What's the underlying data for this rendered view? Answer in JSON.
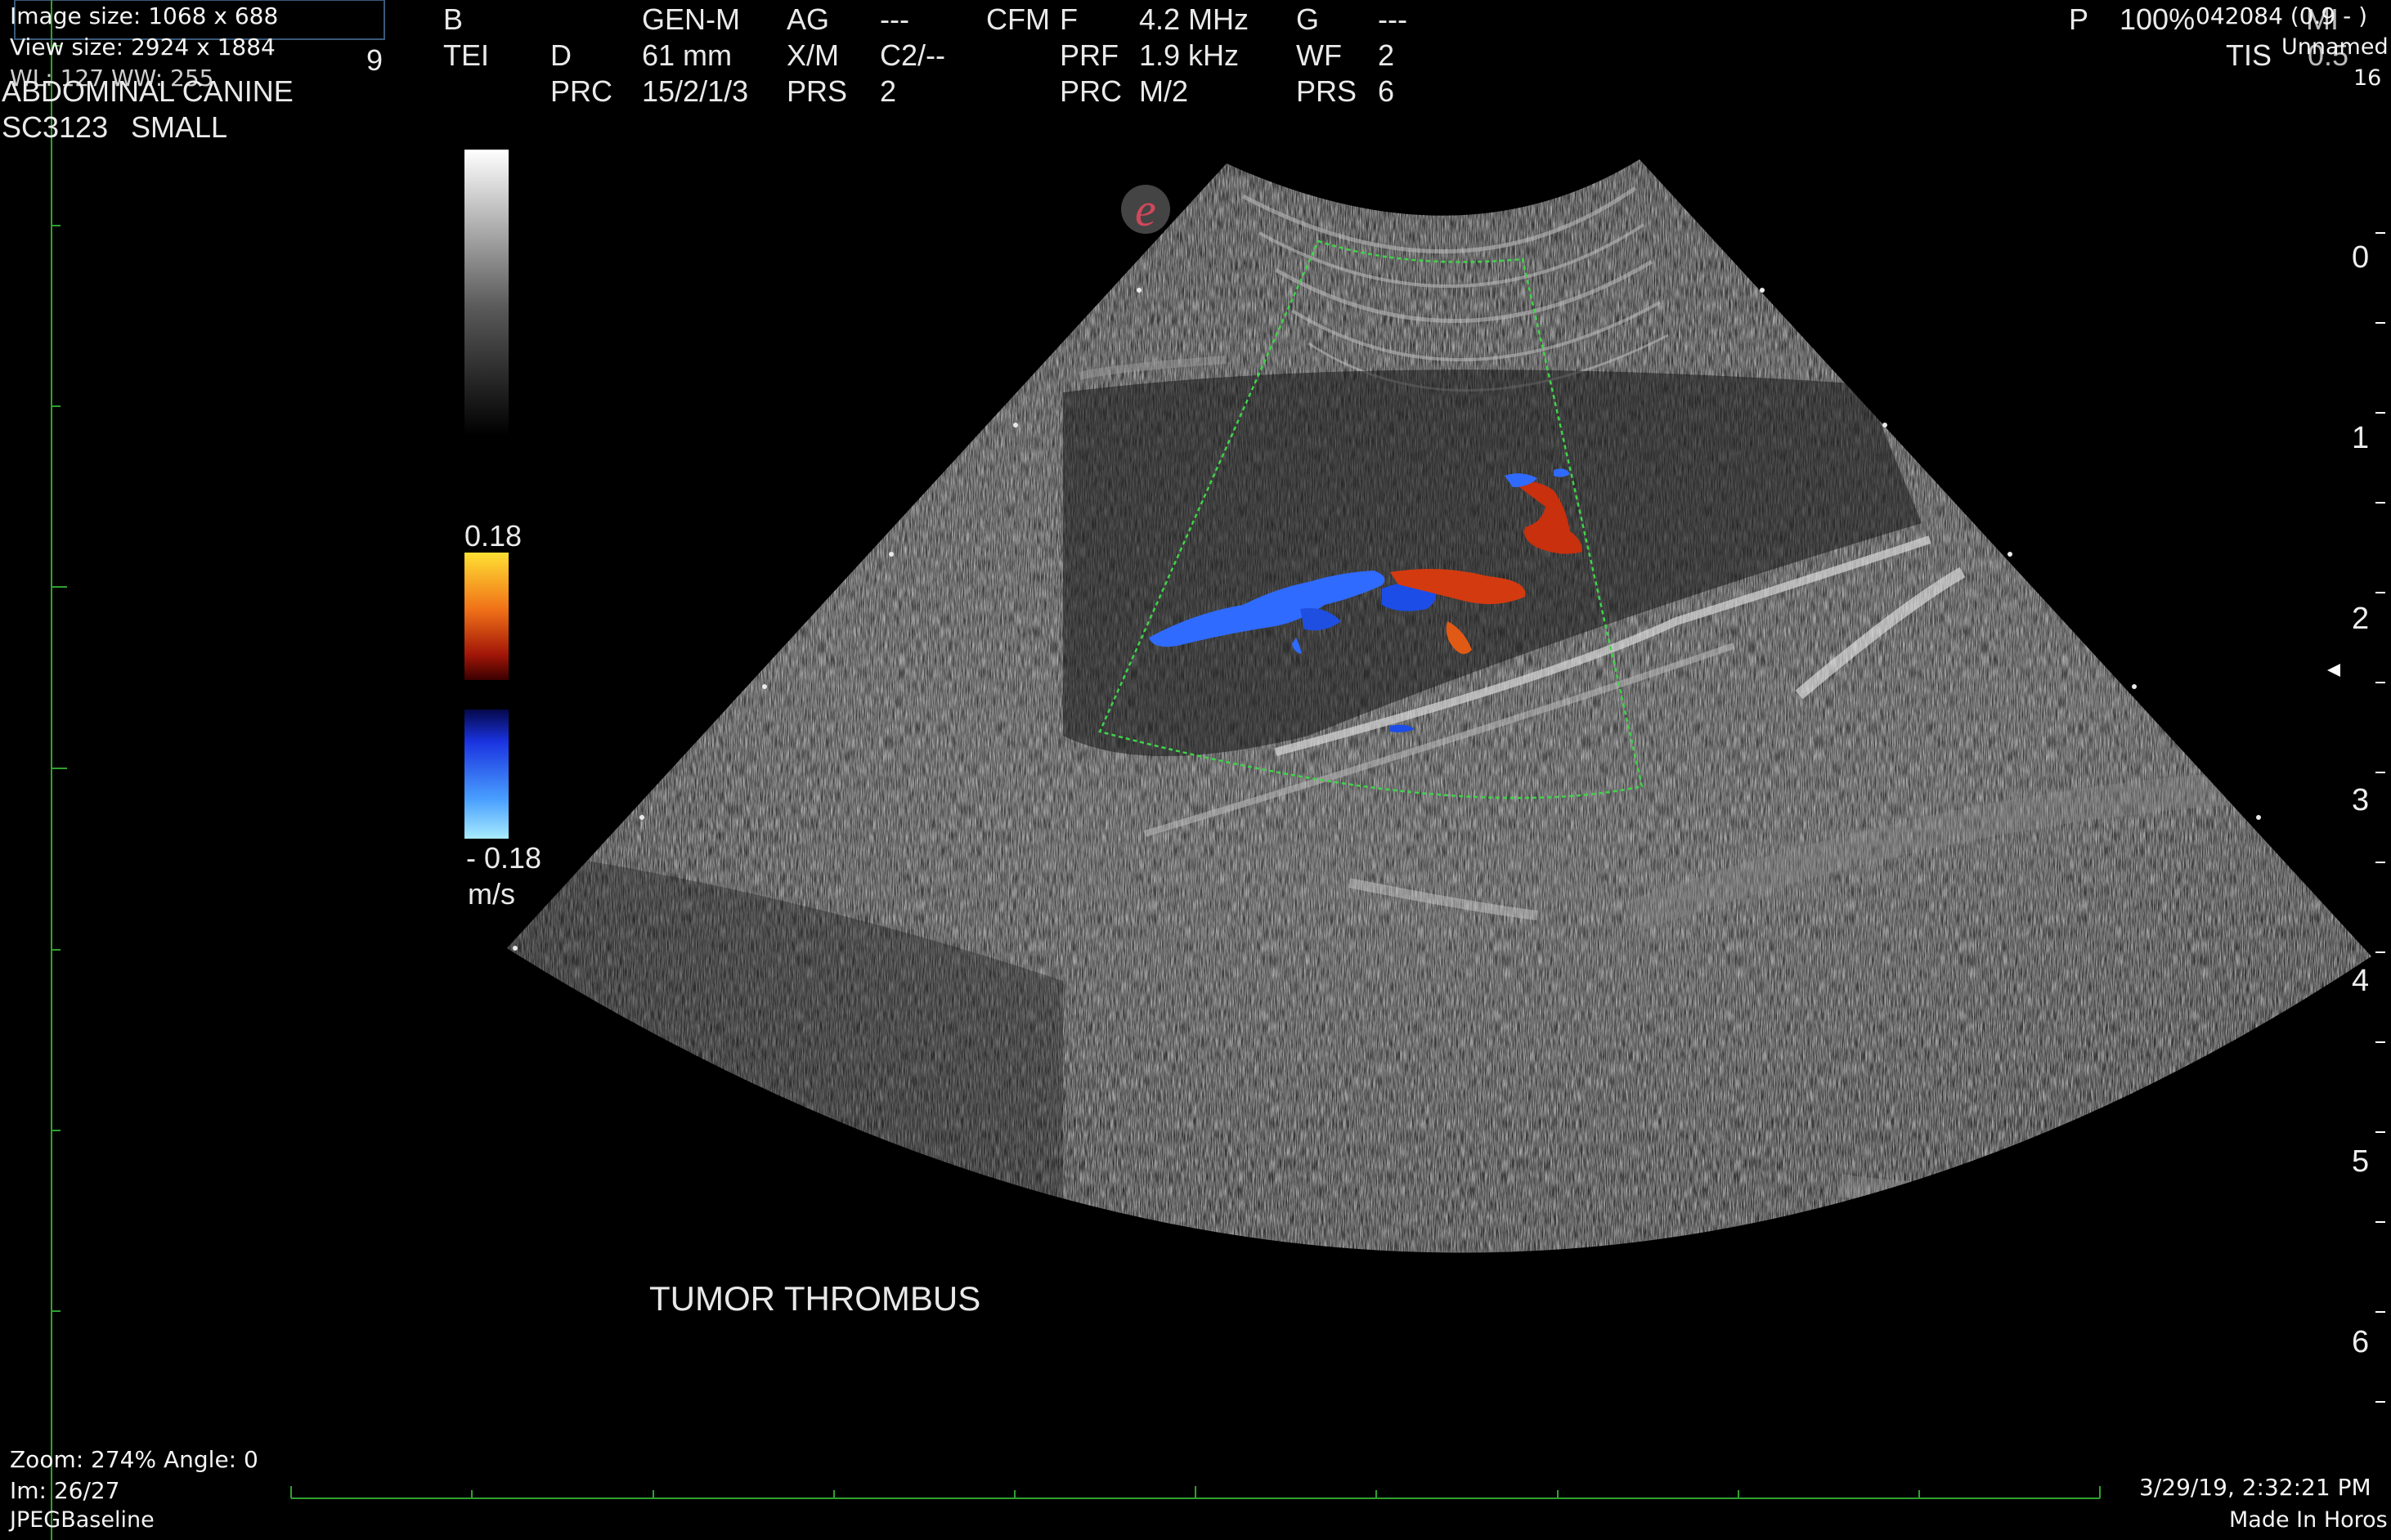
{
  "overlay": {
    "image_size": "Image size: 1068 x 688",
    "view_size": "View size: 2924 x 1884",
    "wl_ww": "WL: 127 WW: 255",
    "zoom_angle": "Zoom: 274% Angle: 0",
    "image_index": "Im: 26/27",
    "compression": "JPEGBaseline",
    "datetime": "3/29/19, 2:32:21 PM",
    "made_in": "Made In Horos",
    "patient_id": "042084 (0.9 - )",
    "patient_name": "Unnamed",
    "series_number": "16"
  },
  "exam": {
    "study": "ABDOMINAL CANINE",
    "probe": "SC3123",
    "size": "SMALL",
    "frame_rate": "9"
  },
  "params": {
    "row1": {
      "c1": "B",
      "c2": "GEN-M",
      "c3": "AG",
      "c4": "---",
      "c5": "CFM",
      "c6": "F",
      "c7": "4.2 MHz",
      "c8": "G",
      "c9": "---"
    },
    "row2": {
      "c1": "TEI",
      "c2": "D",
      "c3": "61 mm",
      "c4": "X/M",
      "c5": "C2/--",
      "c6": "PRF",
      "c7": "1.9 kHz",
      "c8": "WF",
      "c9": "2"
    },
    "row3": {
      "c1": "PRC",
      "c2": "15/2/1/3",
      "c3": "PRS",
      "c4": "2",
      "c5": "PRC",
      "c6": "M/2",
      "c7": "PRS",
      "c8": "6"
    },
    "right": {
      "p": "P",
      "power": "100%",
      "mi": "MI",
      "tis": "TIS",
      "tis_val": "0.5"
    }
  },
  "colorbar": {
    "max_label": "0.18",
    "min_label": "- 0.18",
    "unit": "m/s"
  },
  "depth_scale": [
    "0",
    "1",
    "2",
    "3",
    "4",
    "5",
    "6"
  ],
  "annotation": "TUMOR THROMBUS",
  "colors": {
    "frame_green": "#2fa12f",
    "doppler_red": "#d43a10",
    "doppler_blue": "#2f6bff",
    "roi_green": "#3fd44a"
  }
}
